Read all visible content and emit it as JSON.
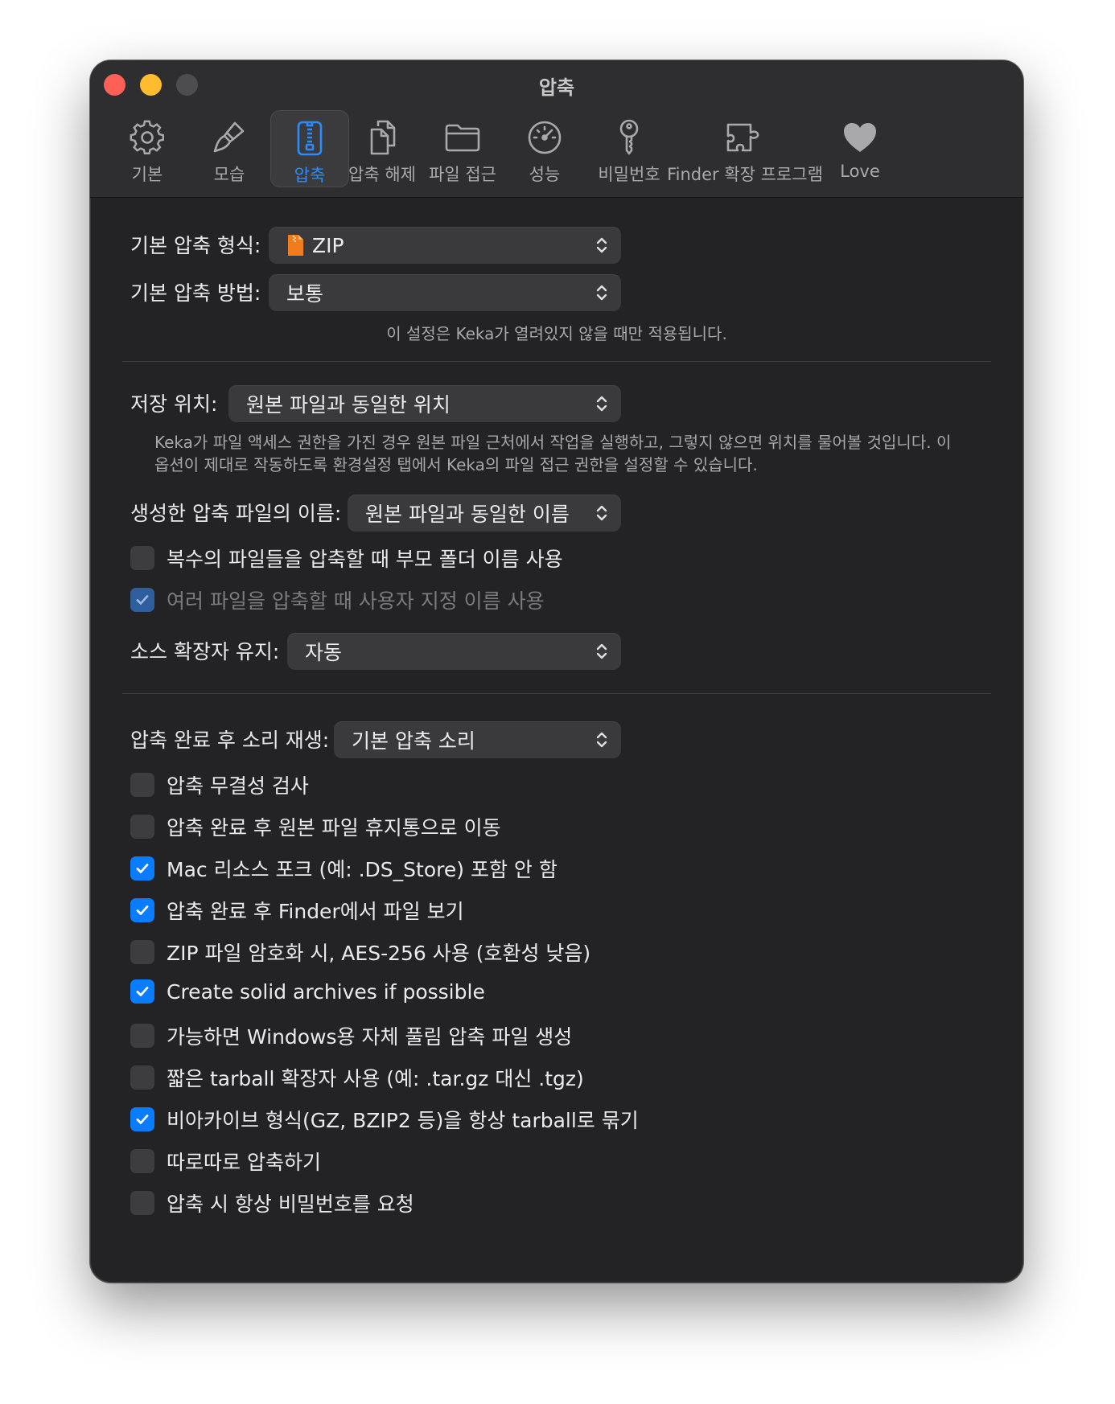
{
  "window": {
    "title": "압축"
  },
  "tabs": [
    {
      "label": "기본",
      "icon": "gear-icon"
    },
    {
      "label": "모습",
      "icon": "paintbrush-icon"
    },
    {
      "label": "압축",
      "icon": "archive-zipper-icon",
      "active": true
    },
    {
      "label": "압축 해제",
      "icon": "documents-icon"
    },
    {
      "label": "파일 접근",
      "icon": "folder-icon"
    },
    {
      "label": "성능",
      "icon": "speedometer-icon"
    },
    {
      "label": "비밀번호",
      "icon": "key-icon"
    },
    {
      "label": "Finder 확장 프로그램",
      "icon": "puzzle-icon"
    },
    {
      "label": "Love",
      "icon": "heart-icon"
    }
  ],
  "format": {
    "label": "기본 압축 형식:",
    "value": "ZIP",
    "icon": "zip-file-icon"
  },
  "method": {
    "label": "기본 압축 방법:",
    "value": "보통"
  },
  "method_note": "이 설정은 Keka가 열려있지 않을 때만 적용됩니다.",
  "save_location": {
    "label": "저장 위치:",
    "value": "원본 파일과 동일한 위치"
  },
  "save_note": [
    "Keka가 파일 액세스 권한을 가진 경우 원본 파일 근처에서 작업을 실행하고, 그렇지 않으면 위치를 물어볼 것입니다. 이",
    "옵션이 제대로 작동하도록 환경설정 탭에서 Keka의 파일 접근 권한을 설정할 수 있습니다."
  ],
  "archive_name": {
    "label": "생성한 압축 파일의 이름:",
    "value": "원본 파일과 동일한 이름"
  },
  "name_checks": [
    {
      "label": "복수의 파일들을 압축할 때 부모 폴더 이름 사용",
      "checked": false,
      "disabled": false
    },
    {
      "label": "여러 파일을 압축할 때 사용자 지정 이름 사용",
      "checked": true,
      "disabled": true
    }
  ],
  "keep_extension": {
    "label": "소스 확장자 유지:",
    "value": "자동"
  },
  "sound": {
    "label": "압축 완료 후 소리 재생:",
    "value": "기본 압축 소리"
  },
  "options": [
    {
      "label": "압축 무결성 검사",
      "checked": false
    },
    {
      "label": "압축 완료 후 원본 파일 휴지통으로 이동",
      "checked": false
    },
    {
      "label": "Mac 리소스 포크 (예: .DS_Store) 포함 안 함",
      "checked": true
    },
    {
      "label": "압축 완료 후 Finder에서 파일 보기",
      "checked": true
    },
    {
      "label": "ZIP 파일 암호화 시, AES-256 사용 (호환성 낮음)",
      "checked": false
    },
    {
      "label": "Create solid archives if possible",
      "checked": true
    },
    {
      "label": "가능하면 Windows용 자체 풀림 압축 파일 생성",
      "checked": false
    },
    {
      "label": "짧은 tarball 확장자 사용 (예: .tar.gz 대신 .tgz)",
      "checked": false
    },
    {
      "label": "비아카이브 형식(GZ, BZIP2 등)을 항상 tarball로 묶기",
      "checked": true
    },
    {
      "label": "따로따로 압축하기",
      "checked": false
    },
    {
      "label": "압축 시 항상 비밀번호를 요청",
      "checked": false
    }
  ],
  "colors": {
    "accent": "#0a7cff",
    "window_bg": "#232325",
    "control_bg": "#3a3a3c"
  }
}
